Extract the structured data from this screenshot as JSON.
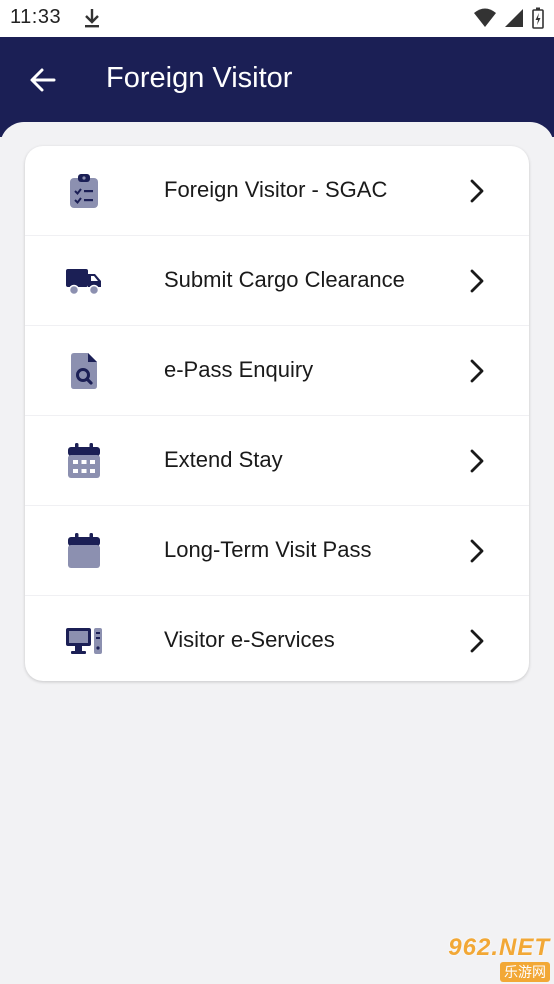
{
  "status_bar": {
    "time": "11:33"
  },
  "header": {
    "title": "Foreign Visitor"
  },
  "menu": {
    "items": [
      {
        "label": "Foreign Visitor - SGAC",
        "icon": "clipboard-check-icon"
      },
      {
        "label": "Submit Cargo Clearance",
        "icon": "truck-icon"
      },
      {
        "label": "e-Pass Enquiry",
        "icon": "document-search-icon"
      },
      {
        "label": "Extend Stay",
        "icon": "calendar-grid-icon"
      },
      {
        "label": "Long-Term Visit Pass",
        "icon": "calendar-icon"
      },
      {
        "label": "Visitor e-Services",
        "icon": "desktop-computer-icon"
      }
    ]
  },
  "watermark": {
    "main": "962.NET",
    "sub": "乐游网"
  },
  "colors": {
    "header_bg": "#1b1f55",
    "icon_dark": "#1b1f55",
    "icon_muted": "#8c90b0",
    "background": "#f2f2f4"
  }
}
